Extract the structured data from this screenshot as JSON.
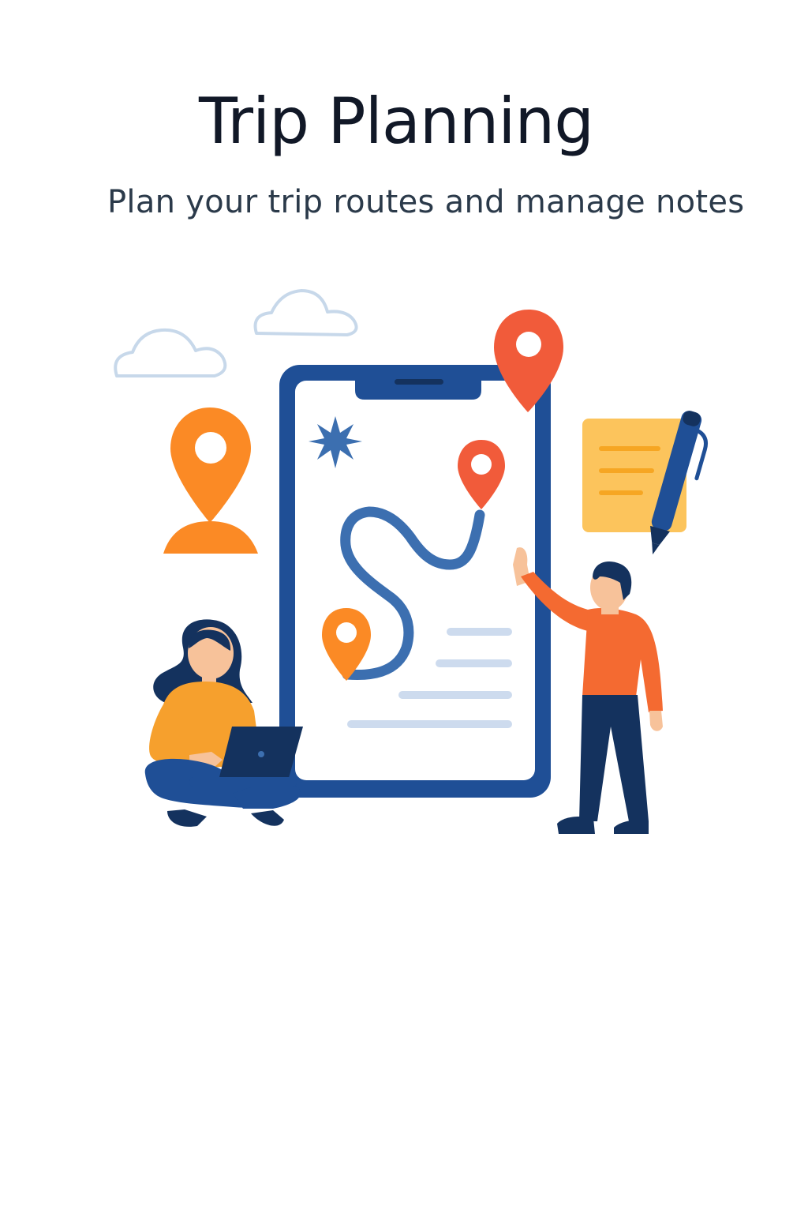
{
  "header": {
    "title": "Trip Planning",
    "subtitle": "Plan your trip routes and manage notes"
  },
  "colors": {
    "title": "#111827",
    "subtitle": "#2b3a4a",
    "navy": "#1f4f96",
    "dark_navy": "#14325e",
    "route": "#3c6fb0",
    "pin_red": "#f15b3a",
    "pin_orange": "#fb8a25",
    "note_yellow": "#fcc45c",
    "note_line": "#f6a623",
    "cloud": "#c7d8ea",
    "text_line": "#cddbee",
    "skin": "#f7c29a",
    "shirt_orange": "#f6a02d",
    "shirt_red": "#f46a31"
  },
  "illustration": {
    "icons": [
      "cloud-icon",
      "map-pin-icon",
      "smartphone-icon",
      "sparkle-icon",
      "route-icon",
      "note-icon",
      "pen-icon",
      "laptop-icon"
    ]
  }
}
